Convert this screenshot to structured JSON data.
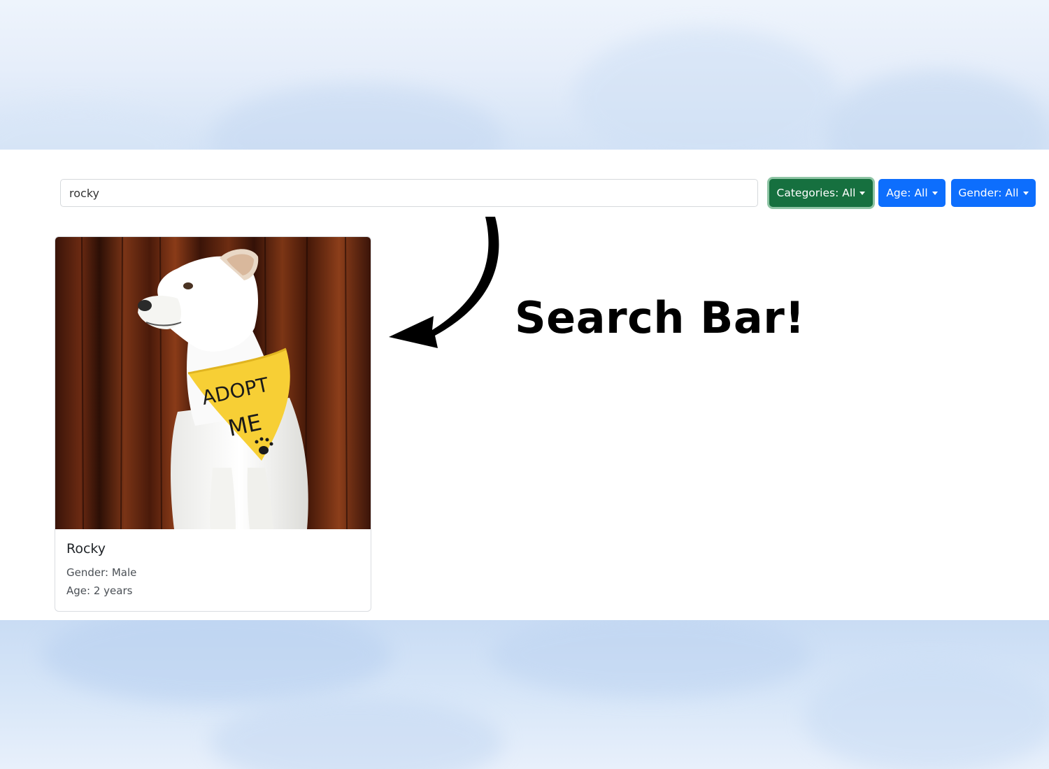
{
  "search": {
    "value": "rocky",
    "placeholder": ""
  },
  "filters": {
    "categories_label": "Categories: All",
    "age_label": "Age: All",
    "gender_label": "Gender: All"
  },
  "results": [
    {
      "name": "Rocky",
      "gender_line": "Gender: Male",
      "age_line": "Age: 2 years",
      "bandana_text_line1": "ADOPT",
      "bandana_text_line2": "ME"
    }
  ],
  "annotation": {
    "text": "Search Bar!"
  },
  "colors": {
    "categories_button": "#16703f",
    "primary_button": "#0d6efd",
    "bandana": "#f7cf35"
  }
}
